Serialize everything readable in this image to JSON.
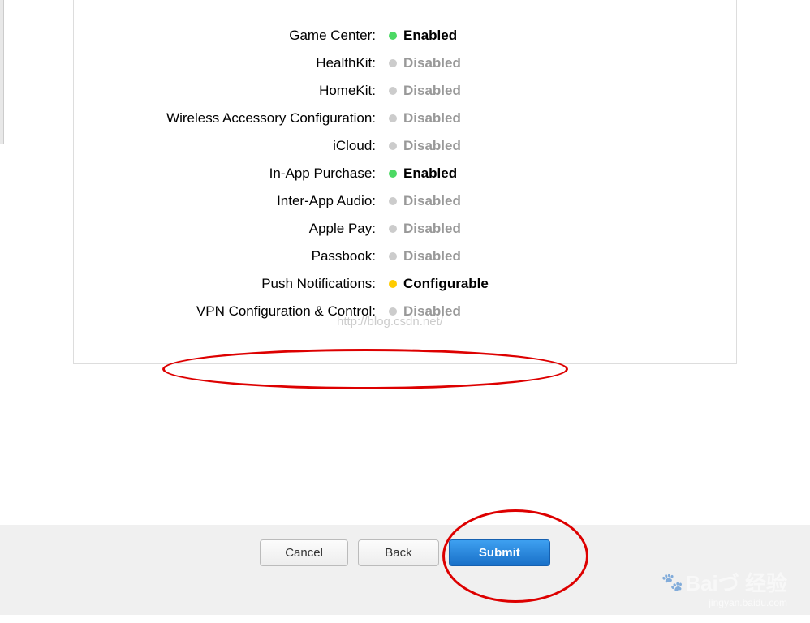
{
  "services": [
    {
      "label": "Game Center:",
      "status": "Enabled",
      "statusType": "enabled"
    },
    {
      "label": "HealthKit:",
      "status": "Disabled",
      "statusType": "disabled"
    },
    {
      "label": "HomeKit:",
      "status": "Disabled",
      "statusType": "disabled"
    },
    {
      "label": "Wireless Accessory Configuration:",
      "status": "Disabled",
      "statusType": "disabled"
    },
    {
      "label": "iCloud:",
      "status": "Disabled",
      "statusType": "disabled"
    },
    {
      "label": "In-App Purchase:",
      "status": "Enabled",
      "statusType": "enabled"
    },
    {
      "label": "Inter-App Audio:",
      "status": "Disabled",
      "statusType": "disabled"
    },
    {
      "label": "Apple Pay:",
      "status": "Disabled",
      "statusType": "disabled"
    },
    {
      "label": "Passbook:",
      "status": "Disabled",
      "statusType": "disabled"
    },
    {
      "label": "Push Notifications:",
      "status": "Configurable",
      "statusType": "configurable"
    },
    {
      "label": "VPN Configuration & Control:",
      "status": "Disabled",
      "statusType": "disabled"
    }
  ],
  "buttons": {
    "cancel": "Cancel",
    "back": "Back",
    "submit": "Submit"
  },
  "watermark": "http://blog.csdn.net/",
  "baidu": {
    "logo": "Baiづ 经验",
    "url": "jingyan.baidu.com"
  }
}
